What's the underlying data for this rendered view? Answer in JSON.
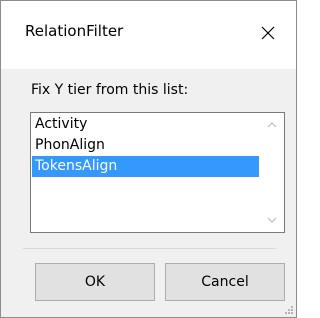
{
  "window": {
    "title": "RelationFilter",
    "close_icon": "close-icon"
  },
  "prompt": "Fix Y tier from this list:",
  "list": {
    "items": [
      "Activity",
      "PhonAlign",
      "TokensAlign"
    ],
    "selected": "TokensAlign"
  },
  "buttons": {
    "ok": "OK",
    "cancel": "Cancel"
  },
  "colors": {
    "selection": "#3399ff",
    "button_bg": "#e1e1e1",
    "dialog_bg": "#f0f0f0"
  }
}
